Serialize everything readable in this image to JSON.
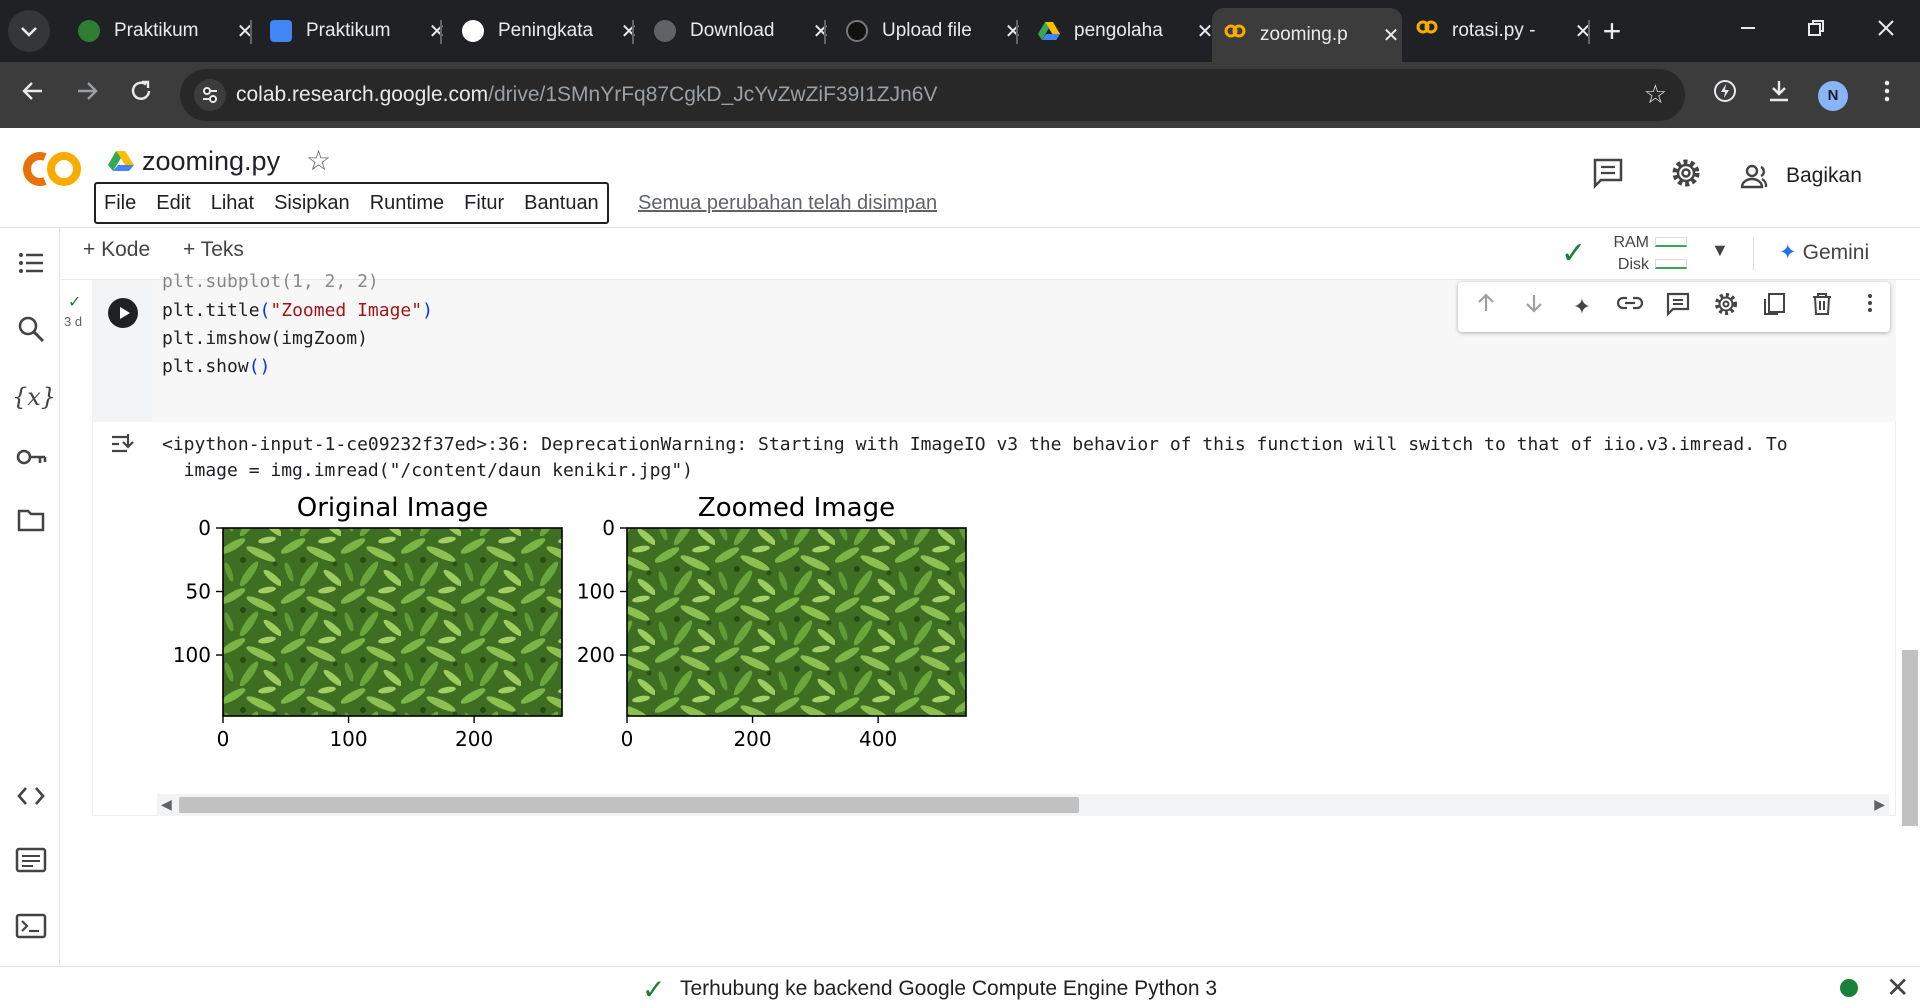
{
  "browser": {
    "tabs": [
      {
        "label": "Praktikum",
        "icon": "chrome-web-store-icon",
        "color": "#2e7d32"
      },
      {
        "label": "Praktikum",
        "icon": "google-docs-icon",
        "color": "#4285f4"
      },
      {
        "label": "Peningkata",
        "icon": "chatgpt-icon",
        "color": "#ffffff"
      },
      {
        "label": "Download",
        "icon": "globe-icon",
        "color": "#5f6368"
      },
      {
        "label": "Upload file",
        "icon": "github-icon",
        "color": "#202124"
      },
      {
        "label": "pengolaha",
        "icon": "google-drive-icon",
        "color": "#fbbc04"
      },
      {
        "label": "zooming.p",
        "icon": "colab-icon",
        "color": "#f9ab00",
        "active": true
      },
      {
        "label": "rotasi.py -",
        "icon": "colab-icon",
        "color": "#f9ab00"
      }
    ],
    "close_glyph": "✕",
    "new_tab_glyph": "+",
    "url_domain": "colab.research.google.com",
    "url_path": "/drive/1SMnYrFq87CgkD_JcYvZwZiF39I1ZJn6V",
    "profile_initial": "N"
  },
  "colab": {
    "notebook_name": "zooming.py",
    "menu": [
      "File",
      "Edit",
      "Lihat",
      "Sisipkan",
      "Runtime",
      "Fitur",
      "Bantuan"
    ],
    "save_status": "Semua perubahan telah disimpan",
    "share_label": "Bagikan",
    "add_code_label": "+ Kode",
    "add_text_label": "+ Teks",
    "ram_label": "RAM",
    "disk_label": "Disk",
    "gemini_label": "Gemini",
    "accent_color": "#f9ab00",
    "status_color": "#188038"
  },
  "cell": {
    "exec_time": "3 d",
    "code_lines": [
      "plt.subplot(1, 2, 2)",
      "plt.title(\"Zoomed Image\")",
      "plt.imshow(imgZoom)",
      "plt.show()"
    ],
    "output_lines": [
      "<ipython-input-1-ce09232f37ed>:36: DeprecationWarning: Starting with ImageIO v3 the behavior of this function will switch to that of iio.v3.imread. To",
      "  image = img.imread(\"/content/daun kenikir.jpg\")"
    ]
  },
  "chart_data": [
    {
      "type": "image",
      "title": "Original Image",
      "xticks": [
        "0",
        "100",
        "200"
      ],
      "yticks": [
        "0",
        "50",
        "100"
      ],
      "xlim": [
        0,
        270
      ],
      "ylim": [
        148,
        0
      ]
    },
    {
      "type": "image",
      "title": "Zoomed Image",
      "xticks": [
        "0",
        "200",
        "400"
      ],
      "yticks": [
        "0",
        "100",
        "200"
      ],
      "xlim": [
        0,
        540
      ],
      "ylim": [
        296,
        0
      ]
    }
  ],
  "statusbar": {
    "text": "Terhubung ke backend Google Compute Engine Python 3"
  }
}
